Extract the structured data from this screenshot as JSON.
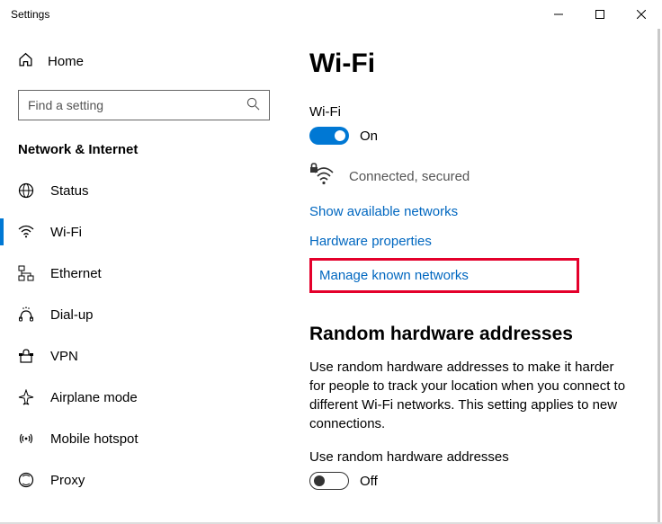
{
  "window": {
    "title": "Settings"
  },
  "sidebar": {
    "home": "Home",
    "searchPlaceholder": "Find a setting",
    "category": "Network & Internet",
    "items": [
      {
        "label": "Status"
      },
      {
        "label": "Wi-Fi"
      },
      {
        "label": "Ethernet"
      },
      {
        "label": "Dial-up"
      },
      {
        "label": "VPN"
      },
      {
        "label": "Airplane mode"
      },
      {
        "label": "Mobile hotspot"
      },
      {
        "label": "Proxy"
      }
    ]
  },
  "main": {
    "heading": "Wi-Fi",
    "wifiLabel": "Wi-Fi",
    "wifiState": "On",
    "connStatus": "Connected, secured",
    "links": {
      "showAvail": "Show available networks",
      "hwProps": "Hardware properties",
      "manageKnown": "Manage known networks"
    },
    "randomSection": {
      "heading": "Random hardware addresses",
      "desc": "Use random hardware addresses to make it harder for people to track your location when you connect to different Wi-Fi networks. This setting applies to new connections.",
      "toggleLabel": "Use random hardware addresses",
      "state": "Off"
    }
  }
}
